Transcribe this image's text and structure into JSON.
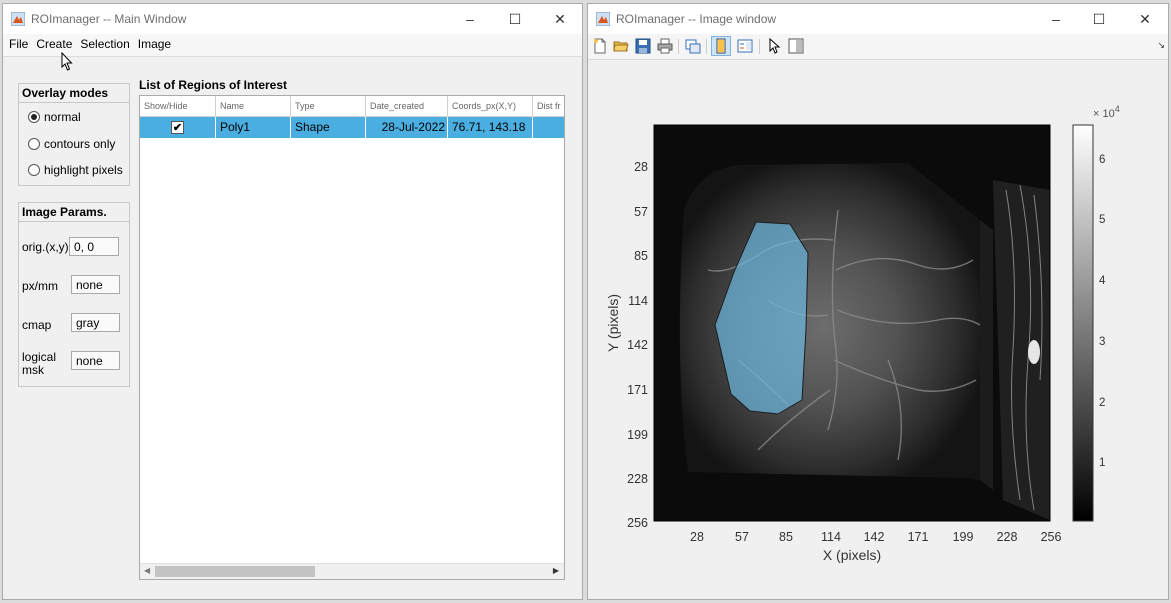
{
  "main_window": {
    "title": "ROImanager -- Main Window",
    "menu": [
      "File",
      "Create",
      "Selection",
      "Image"
    ],
    "overlay_modes": {
      "title": "Overlay modes",
      "options": [
        "normal",
        "contours only",
        "highlight pixels"
      ],
      "selected": "normal"
    },
    "image_params": {
      "title": "Image Params.",
      "orig_label": "orig.(x,y)",
      "orig_value": "0, 0",
      "pxmm_label": "px/mm",
      "pxmm_value": "none",
      "cmap_label": "cmap",
      "cmap_value": "gray",
      "logical_label": "logical",
      "logical_label2": "msk",
      "logical_value": "none"
    },
    "roi_list": {
      "title": "List of Regions of Interest",
      "columns": [
        "Show/Hide",
        "Name",
        "Type",
        "Date_created",
        "Coords_px(X,Y)",
        "Dist fr"
      ],
      "rows": [
        {
          "show": "✔",
          "name": "Poly1",
          "type": "Shape",
          "date": "28-Jul-2022",
          "coords": "76.71, 143.18"
        }
      ]
    }
  },
  "image_window": {
    "title": "ROImanager -- Image window",
    "toolbar_icons": [
      "new-file-icon",
      "open-folder-icon",
      "save-icon",
      "print-icon",
      "copy-figure-icon",
      "data-cursor-icon",
      "legend-icon",
      "pointer-icon",
      "panel-icon"
    ],
    "axes": {
      "xlabel": "X (pixels)",
      "ylabel": "Y (pixels)",
      "xticks": [
        "28",
        "57",
        "85",
        "114",
        "142",
        "171",
        "199",
        "228",
        "256"
      ],
      "yticks": [
        "28",
        "57",
        "85",
        "114",
        "142",
        "171",
        "199",
        "228",
        "256"
      ]
    },
    "colorbar": {
      "exponent_base": "× 10",
      "exponent_power": "4",
      "ticks": [
        "1",
        "2",
        "3",
        "4",
        "5",
        "6"
      ]
    },
    "roi_overlay_color": "#6db9e3"
  }
}
